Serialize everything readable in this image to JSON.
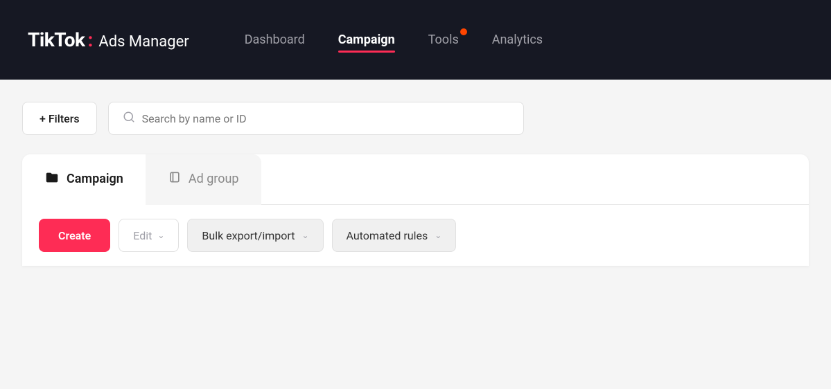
{
  "logo": {
    "tiktok": "TikTok",
    "colon": ":",
    "ads_manager": "Ads Manager"
  },
  "nav": {
    "links": [
      {
        "id": "dashboard",
        "label": "Dashboard",
        "active": false
      },
      {
        "id": "campaign",
        "label": "Campaign",
        "active": true
      },
      {
        "id": "tools",
        "label": "Tools",
        "active": false,
        "has_dot": true
      },
      {
        "id": "analytics",
        "label": "Analytics",
        "active": false
      }
    ]
  },
  "filter_bar": {
    "filter_label": "+ Filters",
    "search_placeholder": "Search by name or ID"
  },
  "tabs": [
    {
      "id": "campaign",
      "label": "Campaign",
      "icon": "🗂",
      "active": true
    },
    {
      "id": "ad_group",
      "label": "Ad group",
      "icon": "📋",
      "active": false
    }
  ],
  "actions": {
    "create_label": "Create",
    "edit_label": "Edit",
    "bulk_label": "Bulk export/import",
    "automated_label": "Automated rules"
  },
  "colors": {
    "brand_red": "#fe2c55",
    "tools_dot": "#ff4500"
  }
}
